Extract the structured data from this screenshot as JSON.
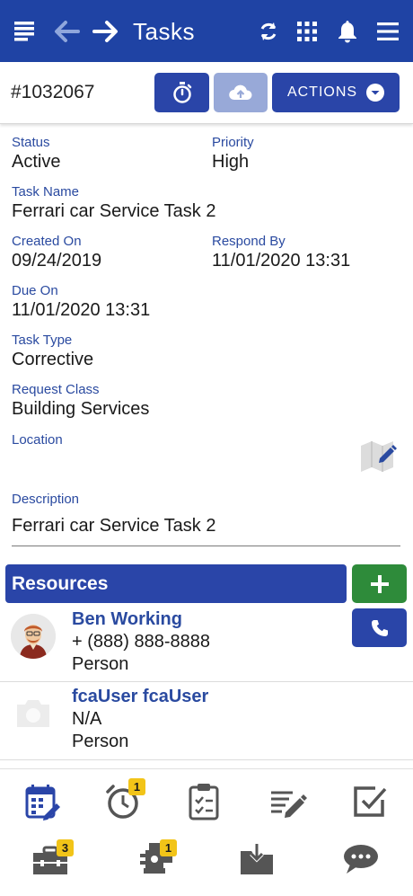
{
  "header": {
    "title": "Tasks",
    "icons": [
      "list-icon",
      "back-arrow-icon",
      "forward-arrow-icon",
      "sync-icon",
      "apps-grid-icon",
      "bell-icon",
      "menu-icon"
    ]
  },
  "task": {
    "id": "#1032067",
    "actions_label": "ACTIONS"
  },
  "fields": {
    "status_label": "Status",
    "status_value": "Active",
    "priority_label": "Priority",
    "priority_value": "High",
    "task_name_label": "Task Name",
    "task_name_value": "Ferrari car Service Task 2",
    "created_label": "Created On",
    "created_value": "09/24/2019",
    "respond_label": "Respond By",
    "respond_value": "11/01/2020 13:31",
    "due_label": "Due On",
    "due_value": "11/01/2020 13:31",
    "type_label": "Task Type",
    "type_value": "Corrective",
    "class_label": "Request Class",
    "class_value": "Building Services",
    "location_label": "Location",
    "description_label": "Description",
    "description_value": "Ferrari car Service Task 2"
  },
  "resources": {
    "title": "Resources",
    "items": [
      {
        "name": "Ben Working",
        "phone": "+ (888) 888-8888",
        "kind": "Person"
      },
      {
        "name": "fcaUser fcaUser",
        "phone": "N/A",
        "kind": "Person"
      }
    ]
  },
  "bottom_nav": {
    "badges": {
      "timer": "1",
      "toolbox": "3",
      "parts": "1"
    }
  },
  "colors": {
    "primary": "#1f43a4",
    "add_green": "#2e8b3a",
    "badge": "#f2c418"
  }
}
